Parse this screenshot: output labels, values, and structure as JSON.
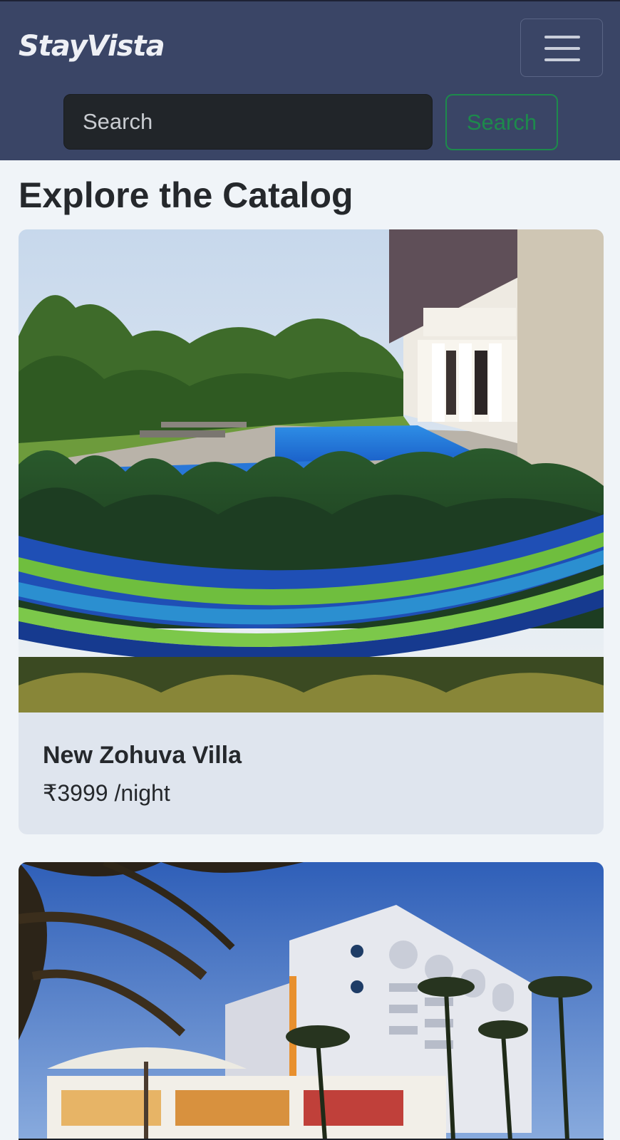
{
  "navbar": {
    "brand": "StayVista",
    "search_placeholder": "Search",
    "search_button": "Search"
  },
  "main": {
    "title": "Explore the Catalog",
    "listings": [
      {
        "title": "New Zohuva Villa",
        "price": "₹3999 /night"
      },
      {
        "title": "",
        "price": ""
      }
    ]
  },
  "colors": {
    "navbar_bg": "#3a4566",
    "search_input_bg": "#212529",
    "search_button": "#1d8a4c",
    "page_bg": "#f0f4f8",
    "card_body_bg": "#dfe5ee"
  }
}
